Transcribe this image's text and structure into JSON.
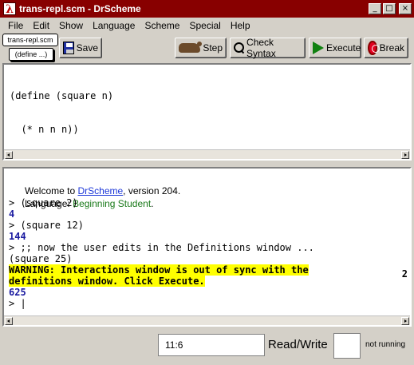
{
  "window": {
    "title": "trans-repl.scm - DrScheme",
    "icon_glyph": "λ",
    "controls": {
      "minimize": "_",
      "maximize": "□",
      "close": "×"
    }
  },
  "menu": [
    "File",
    "Edit",
    "Show",
    "Language",
    "Scheme",
    "Special",
    "Help"
  ],
  "toolbar": {
    "file_tab": "trans-repl.scm",
    "define_popup": "(define ...)",
    "save_label": "Save",
    "step_label": "Step",
    "check_syntax_label": "Check Syntax",
    "execute_label": "Execute",
    "break_label": "Break"
  },
  "definitions": {
    "lines": [
      "(define (square n)",
      "  (* n n n))"
    ]
  },
  "interactions": {
    "welcome_prefix": "Welcome to ",
    "welcome_link": "DrScheme",
    "welcome_suffix": ", version 204.",
    "language_prefix": "Language: ",
    "language_name": "Beginning Student",
    "language_suffix": ".",
    "line1": "> (square 2)",
    "result1": "4",
    "line2": "> (square 12)",
    "result2": "144",
    "line3": "> ;; now the user edits in the Definitions window ...",
    "line4": "(square 25)",
    "warning1": "WARNING: Interactions window is out of sync with the",
    "warning2": "definitions window. Click Execute.",
    "result3": "625",
    "prompt": "> |",
    "wrap_marker": "2"
  },
  "status": {
    "position": "11:6",
    "mode": "Read/Write",
    "running": "not running"
  },
  "colors": {
    "title_bg": "#880000",
    "link": "#1b36d8",
    "language": "#1a7a1a",
    "result": "#1a1aa0",
    "warning_bg": "#ffff00"
  }
}
